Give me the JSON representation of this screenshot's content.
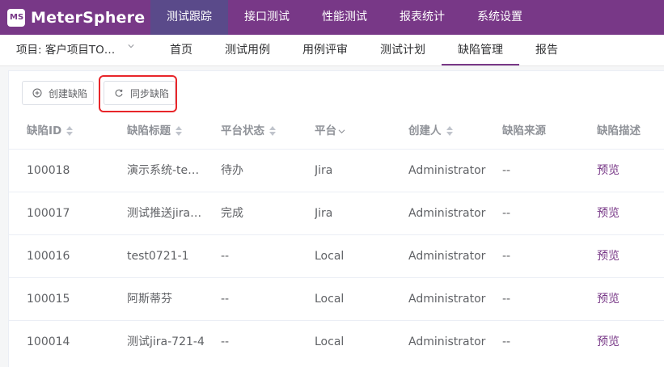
{
  "header": {
    "logo_text": "MeterSphere",
    "nav": [
      "测试跟踪",
      "接口测试",
      "性能测试",
      "报表统计",
      "系统设置"
    ]
  },
  "subheader": {
    "project": "项目: 客户项目TO…",
    "tabs": [
      "首页",
      "测试用例",
      "用例评审",
      "测试计划",
      "缺陷管理",
      "报告"
    ]
  },
  "toolbar": {
    "create_label": "创建缺陷",
    "sync_label": "同步缺陷"
  },
  "table": {
    "columns": [
      "缺陷ID",
      "缺陷标题",
      "平台状态",
      "平台",
      "创建人",
      "缺陷来源",
      "缺陷描述"
    ],
    "rows": [
      {
        "id": "100018",
        "title": "演示系统-te…",
        "status": "待办",
        "platform": "Jira",
        "creator": "Administrator",
        "source": "--",
        "desc": "预览"
      },
      {
        "id": "100017",
        "title": "测试推送jira…",
        "status": "完成",
        "platform": "Jira",
        "creator": "Administrator",
        "source": "--",
        "desc": "预览"
      },
      {
        "id": "100016",
        "title": "test0721-1",
        "status": "--",
        "platform": "Local",
        "creator": "Administrator",
        "source": "--",
        "desc": "预览"
      },
      {
        "id": "100015",
        "title": "阿斯蒂芬",
        "status": "--",
        "platform": "Local",
        "creator": "Administrator",
        "source": "--",
        "desc": "预览"
      },
      {
        "id": "100014",
        "title": "测试jira-721-4",
        "status": "--",
        "platform": "Local",
        "creator": "Administrator",
        "source": "--",
        "desc": "预览"
      }
    ]
  }
}
